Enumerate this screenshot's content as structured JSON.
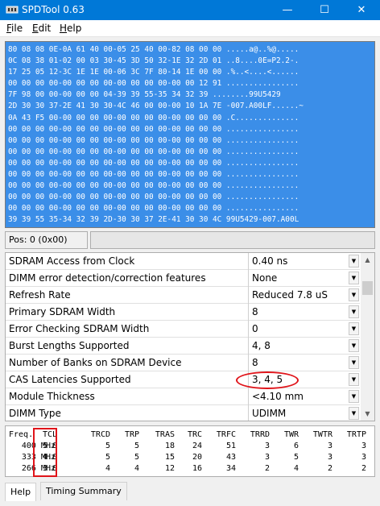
{
  "window": {
    "title": "SPDTool 0.63",
    "minimize_glyph": "—",
    "maximize_glyph": "☐",
    "close_glyph": "✕",
    "titlebar_color": "#0078d7"
  },
  "menu": {
    "file": {
      "accel": "F",
      "rest": "ile"
    },
    "edit": {
      "accel": "E",
      "rest": "dit"
    },
    "help": {
      "accel": "H",
      "rest": "elp"
    }
  },
  "hex_lines": [
    "80 08 08 0E-0A 61 40 00-05 25 40 00-82 08 00 00 .....a@..%@.....",
    "0C 08 38 01-02 00 03 30-45 3D 50 32-1E 32 2D 01 ..8....0E=P2.2-.",
    "17 25 05 12-3C 1E 1E 00-06 3C 7F 80-14 1E 00 00 .%..<....<......",
    "00 00 00 00-00 00 00 00-00 00 00 00-00 00 12 91 ................",
    "7F 98 00 00-00 00 00 04-39 39 55-35 34 32 39 ........99U5429",
    "2D 30 30 37-2E 41 30 30-4C 46 00 00-00 10 1A 7E -007.A00LF......~",
    "0A 43 F5 00-00 00 00 00-00 00 00 00-00 00 00 00 .C..............",
    "00 00 00 00-00 00 00 00-00 00 00 00-00 00 00 00 ................",
    "00 00 00 00-00 00 00 00-00 00 00 00-00 00 00 00 ................",
    "00 00 00 00-00 00 00 00-00 00 00 00-00 00 00 00 ................",
    "00 00 00 00-00 00 00 00-00 00 00 00-00 00 00 00 ................",
    "00 00 00 00-00 00 00 00-00 00 00 00-00 00 00 00 ................",
    "00 00 00 00-00 00 00 00-00 00 00 00-00 00 00 00 ................",
    "00 00 00 00-00 00 00 00-00 00 00 00-00 00 00 00 ................",
    "00 00 00 00-00 00 00 00-00 00 00 00-00 00 00 00 ................",
    "39 39 55 35-34 32 39 2D-30 30 37 2E-41 30 30 4C 99U5429-007.A00L"
  ],
  "status": {
    "position": "Pos: 0 (0x00)"
  },
  "properties": [
    {
      "name": "SDRAM Access from Clock",
      "value": "0.40 ns"
    },
    {
      "name": "DIMM error detection/correction features",
      "value": "None"
    },
    {
      "name": "Refresh Rate",
      "value": "Reduced 7.8 uS"
    },
    {
      "name": "Primary SDRAM Width",
      "value": "8"
    },
    {
      "name": "Error Checking SDRAM Width",
      "value": "0"
    },
    {
      "name": "Burst Lengths Supported",
      "value": "4, 8"
    },
    {
      "name": "Number of Banks on SDRAM Device",
      "value": "8"
    },
    {
      "name": "CAS Latencies Supported",
      "value": "3, 4, 5"
    },
    {
      "name": "Module Thickness",
      "value": "<4.10 mm"
    },
    {
      "name": "DIMM Type",
      "value": "UDIMM"
    }
  ],
  "timing": {
    "headers": [
      "Freq.",
      "TCL",
      "TRCD",
      "TRP",
      "TRAS",
      "TRC",
      "TRFC",
      "TRRD",
      "TWR",
      "TWTR",
      "TRTP"
    ],
    "rows": [
      [
        "400 MHz",
        "5.0",
        "5",
        "5",
        "18",
        "24",
        "51",
        "3",
        "6",
        "3",
        "3"
      ],
      [
        "333 MHz",
        "4.0",
        "5",
        "5",
        "15",
        "20",
        "43",
        "3",
        "5",
        "3",
        "3"
      ],
      [
        "266 MHz",
        "3.0",
        "4",
        "4",
        "12",
        "16",
        "34",
        "2",
        "4",
        "2",
        "2"
      ]
    ]
  },
  "tabs": [
    {
      "label": "Help",
      "active": true
    },
    {
      "label": "Timing Summary",
      "active": false
    }
  ],
  "annotation_color": "#e0141a"
}
